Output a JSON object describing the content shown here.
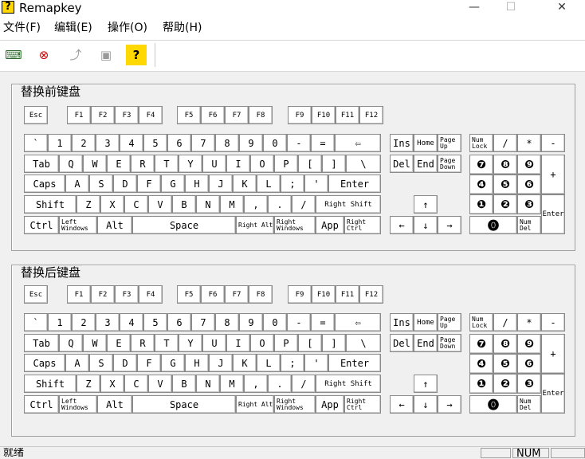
{
  "window": {
    "title": "Remapkey",
    "app_icon_glyph": "?",
    "minimize": "—",
    "maximize": "☐",
    "close": "✕"
  },
  "menu": [
    "文件(F)",
    "编辑(E)",
    "操作(O)",
    "帮助(H)"
  ],
  "toolbar": [
    {
      "icon": "open-keyboard-icon",
      "glyph": "⌨"
    },
    {
      "icon": "delete-mapping-icon",
      "glyph": "⊗"
    },
    {
      "icon": "apply-icon",
      "glyph": "⤴"
    },
    {
      "icon": "clipboard-icon",
      "glyph": "▣"
    },
    {
      "icon": "help-icon",
      "glyph": "?"
    }
  ],
  "groups": [
    {
      "title": "替换前键盘"
    },
    {
      "title": "替换后键盘"
    }
  ],
  "keys": {
    "fn_row": [
      "Esc",
      "F1",
      "F2",
      "F3",
      "F4",
      "F5",
      "F6",
      "F7",
      "F8",
      "F9",
      "F10",
      "F11",
      "F12"
    ],
    "num_row": [
      "`",
      "1",
      "2",
      "3",
      "4",
      "5",
      "6",
      "7",
      "8",
      "9",
      "0",
      "-",
      "=",
      "⇦"
    ],
    "tab_row": [
      "Tab",
      "Q",
      "W",
      "E",
      "R",
      "T",
      "Y",
      "U",
      "I",
      "O",
      "P",
      "[",
      "]",
      "\\"
    ],
    "caps_row": [
      "Caps",
      "A",
      "S",
      "D",
      "F",
      "G",
      "H",
      "J",
      "K",
      "L",
      ";",
      "'",
      "Enter"
    ],
    "shift_row": [
      "Shift",
      "Z",
      "X",
      "C",
      "V",
      "B",
      "N",
      "M",
      ",",
      ".",
      "/",
      "Right Shift"
    ],
    "bottom_row": [
      "Ctrl",
      "Left Windows",
      "Alt",
      "Space",
      "Right Alt",
      "Right Windows",
      "App",
      "Right Ctrl"
    ],
    "nav_top": [
      "Ins",
      "Home",
      "Page Up"
    ],
    "nav_bottom": [
      "Del",
      "End",
      "Page Down"
    ],
    "arrows": [
      "↑",
      "←",
      "↓",
      "→"
    ],
    "numpad_top": [
      "Num Lock",
      "/",
      "*",
      "-"
    ],
    "numpad_7": [
      "❼",
      "❽",
      "❾"
    ],
    "numpad_4": [
      "❹",
      "❺",
      "❻"
    ],
    "numpad_1": [
      "❶",
      "❷",
      "❸"
    ],
    "numpad_0": "⓿",
    "numpad_del": "Num Del",
    "numpad_plus": "+",
    "numpad_enter": "Enter"
  },
  "status": {
    "text": "就绪",
    "num": "NUM"
  }
}
